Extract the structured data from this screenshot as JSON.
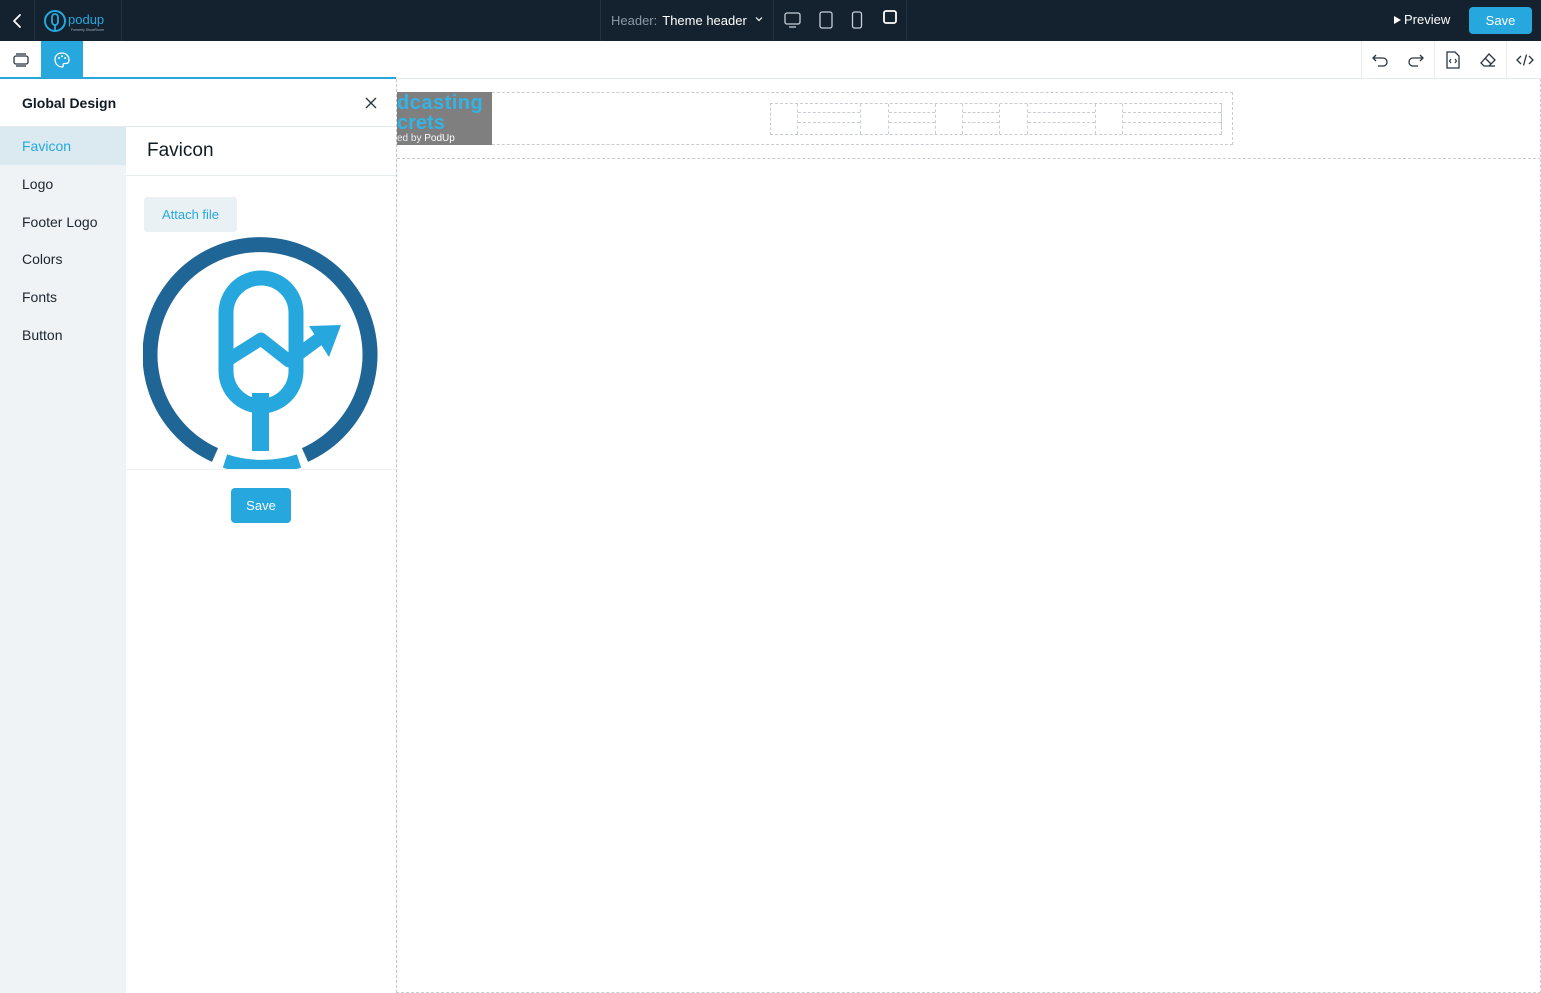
{
  "topbar": {
    "logo_text": "podup",
    "logo_subtext": "Formerly ShowRoom",
    "header_label": "Header:",
    "header_value": "Theme header",
    "preview_label": "Preview",
    "save_label": "Save"
  },
  "toolbar": {
    "left": [
      "layers-icon",
      "palette-icon"
    ],
    "right": [
      "undo-icon",
      "redo-icon",
      "export-icon",
      "eraser-icon",
      "code-icon"
    ]
  },
  "panel": {
    "title": "Global Design",
    "nav": [
      {
        "label": "Favicon",
        "active": true
      },
      {
        "label": "Logo",
        "active": false
      },
      {
        "label": "Footer Logo",
        "active": false
      },
      {
        "label": "Colors",
        "active": false
      },
      {
        "label": "Fonts",
        "active": false
      },
      {
        "label": "Button",
        "active": false
      }
    ],
    "section_title": "Favicon",
    "attach_label": "Attach file",
    "save_label": "Save"
  },
  "canvas": {
    "logo_line1": "dcasting",
    "logo_line2": "crets",
    "logo_line3_prefix": "ed by ",
    "logo_line3_brand": "PodUp"
  },
  "colors": {
    "accent": "#26a8df",
    "topbar_bg": "#14222f",
    "favicon_dark": "#1f6596",
    "favicon_light": "#26a8df"
  }
}
